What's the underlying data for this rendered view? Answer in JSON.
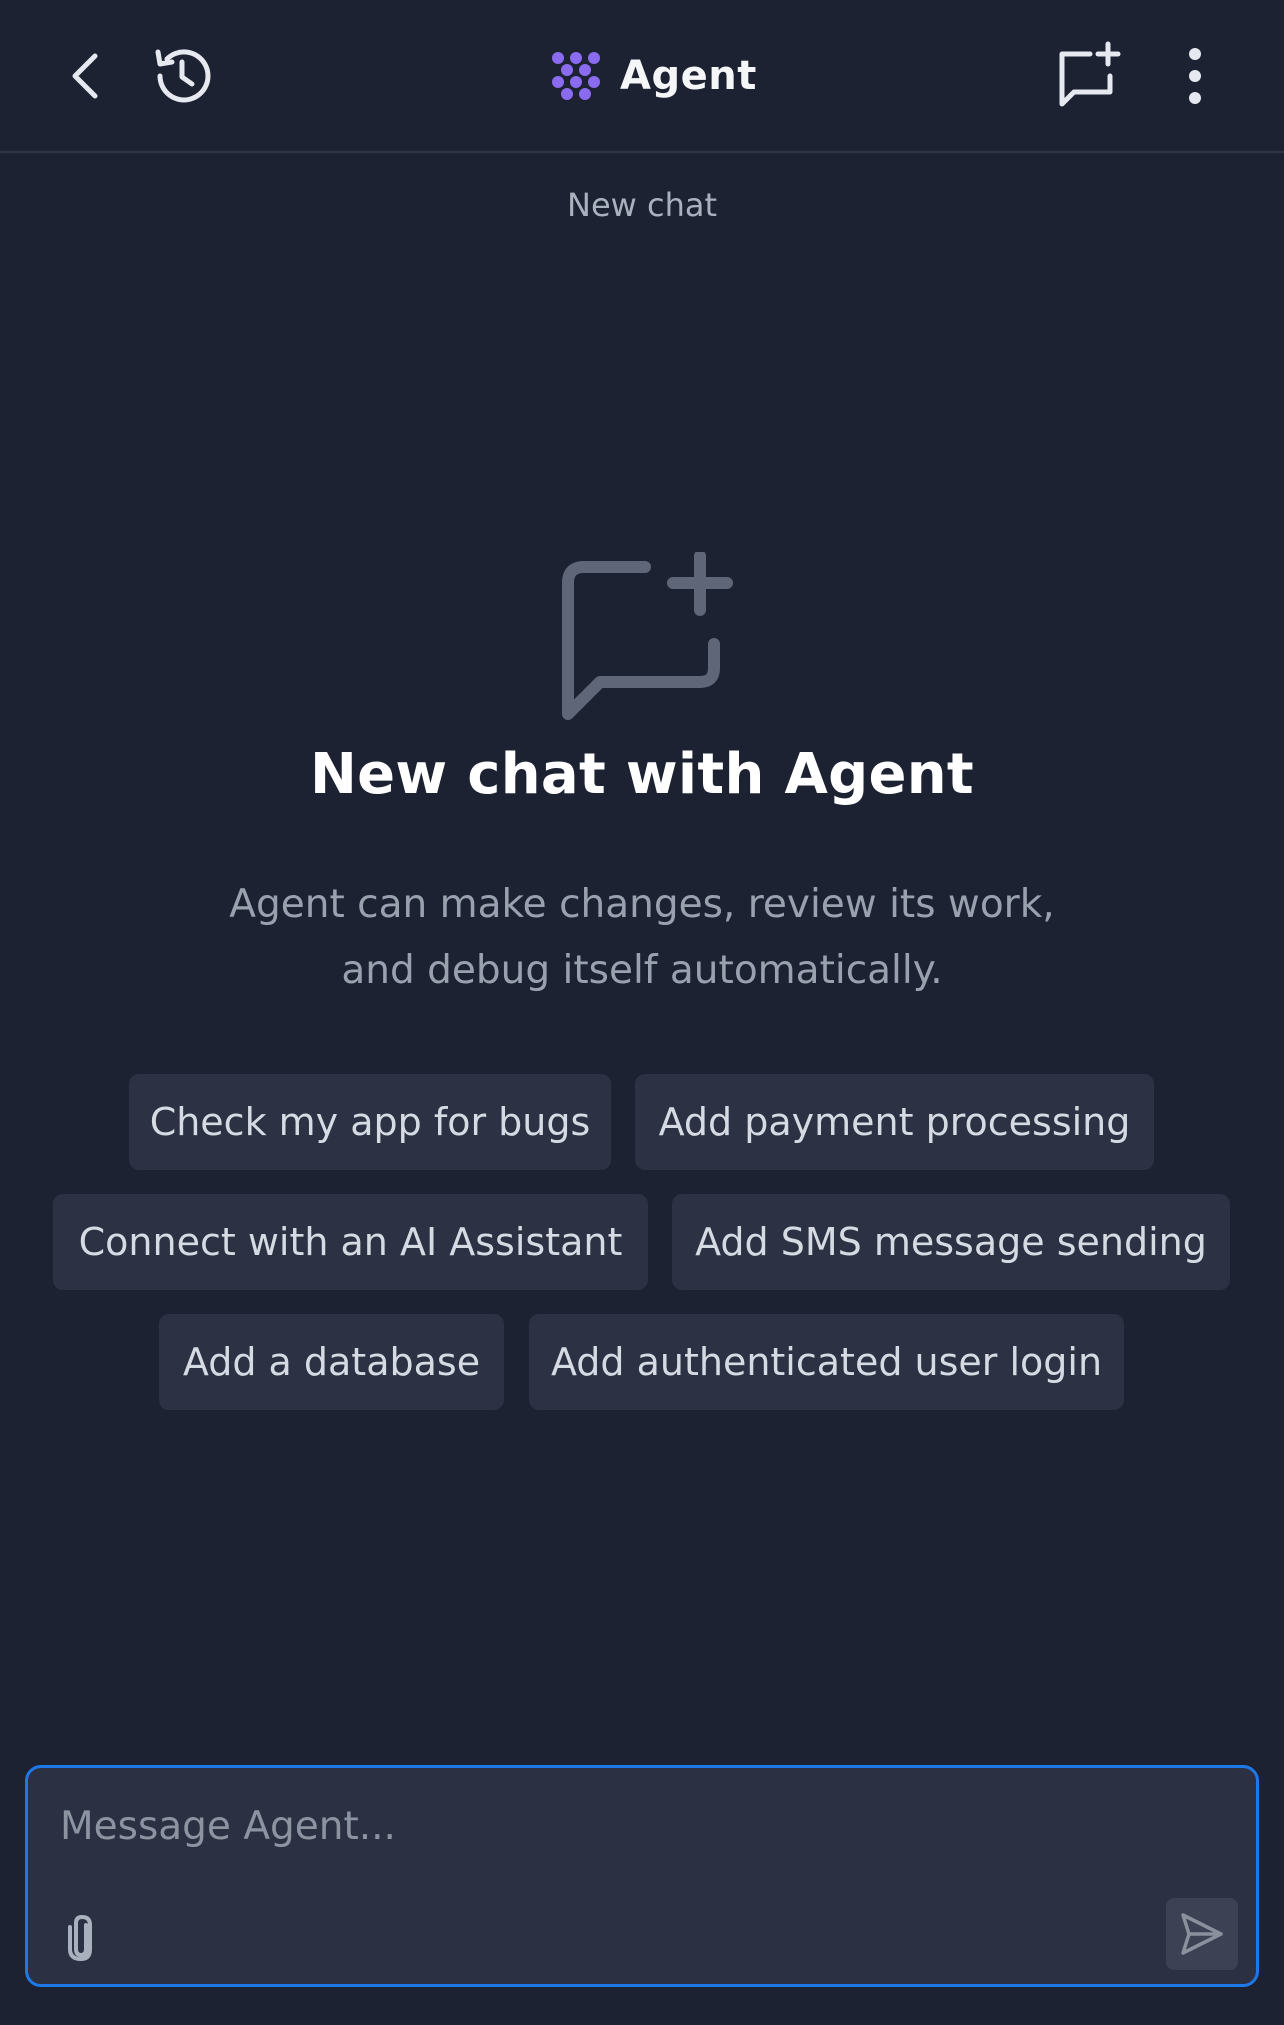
{
  "header": {
    "title": "Agent",
    "icons": {
      "back": "chevron-left-icon",
      "history": "history-icon",
      "brand": "agent-logo-icon",
      "new_chat": "new-chat-icon",
      "more": "more-vertical-icon"
    }
  },
  "subtitle": "New chat",
  "hero": {
    "icon": "chat-plus-icon",
    "title": "New chat with Agent",
    "description": "Agent can make changes, review its work, and debug itself automatically."
  },
  "suggestions": [
    "Check my app for bugs",
    "Add payment processing",
    "Connect with an AI Assistant",
    "Add SMS message sending",
    "Add a database",
    "Add authenticated user login"
  ],
  "composer": {
    "placeholder": "Message Agent...",
    "value": "",
    "attach_icon": "paperclip-icon",
    "send_icon": "send-icon"
  },
  "colors": {
    "background": "#1c2232",
    "chip": "#2c3243",
    "accent_border": "#1f78e8",
    "brand_purple": "#8b6cf0"
  }
}
